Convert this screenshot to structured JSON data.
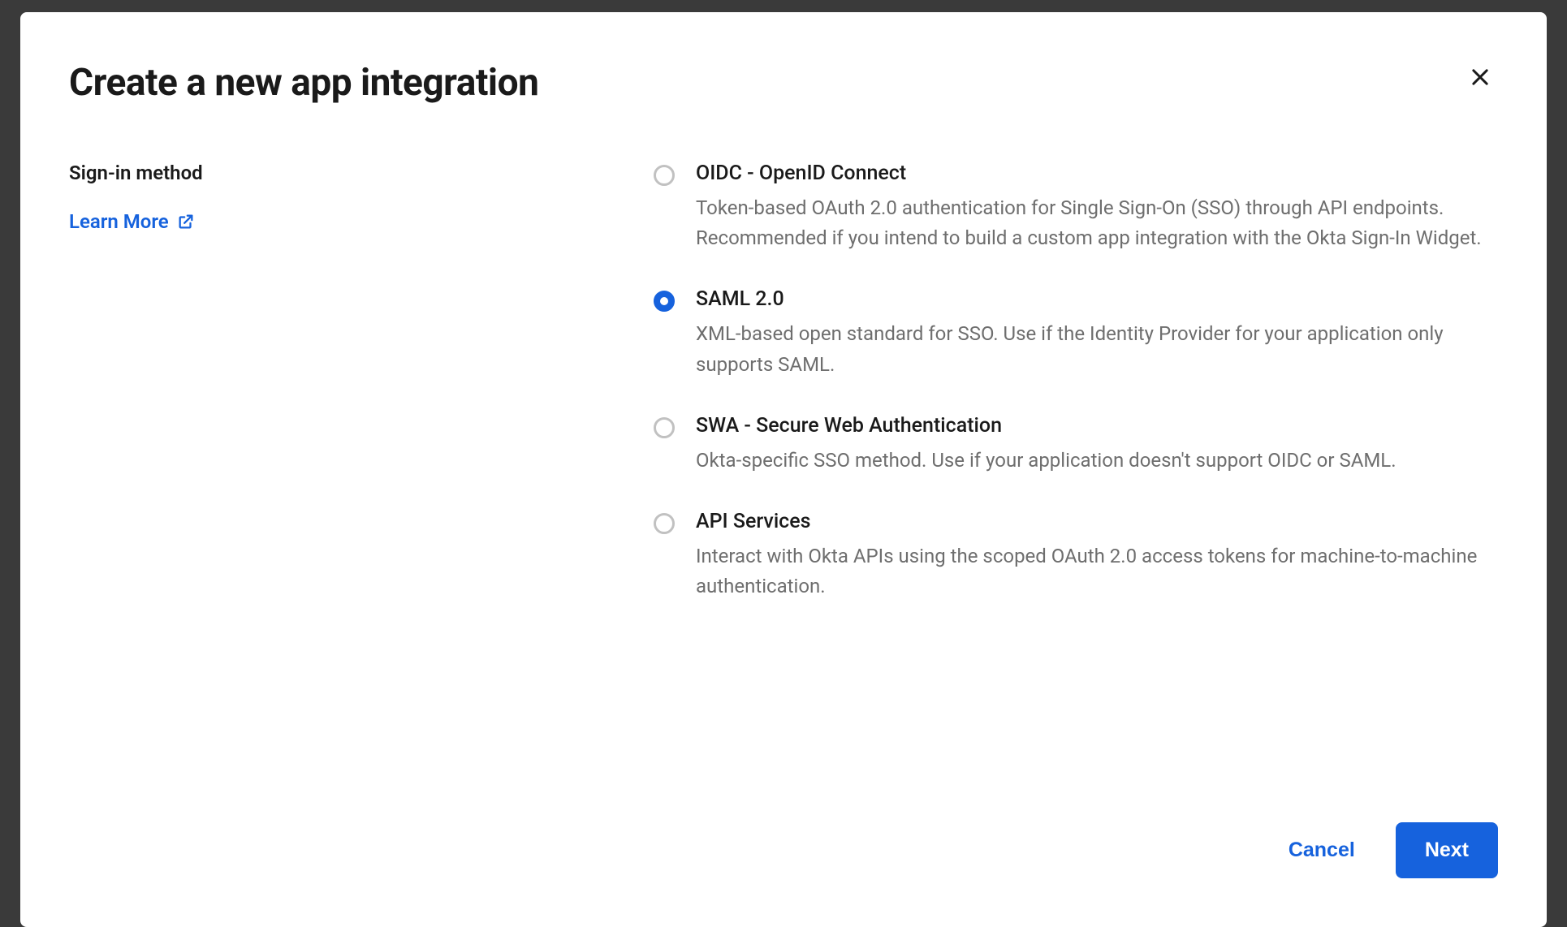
{
  "modal": {
    "title": "Create a new app integration",
    "section_label": "Sign-in method",
    "learn_more": "Learn More",
    "options": [
      {
        "id": "oidc",
        "title": "OIDC - OpenID Connect",
        "desc": "Token-based OAuth 2.0 authentication for Single Sign-On (SSO) through API endpoints. Recommended if you intend to build a custom app integration with the Okta Sign-In Widget.",
        "selected": false
      },
      {
        "id": "saml",
        "title": "SAML 2.0",
        "desc": "XML-based open standard for SSO. Use if the Identity Provider for your application only supports SAML.",
        "selected": true
      },
      {
        "id": "swa",
        "title": "SWA - Secure Web Authentication",
        "desc": "Okta-specific SSO method. Use if your application doesn't support OIDC or SAML.",
        "selected": false
      },
      {
        "id": "api",
        "title": "API Services",
        "desc": "Interact with Okta APIs using the scoped OAuth 2.0 access tokens for machine-to-machine authentication.",
        "selected": false
      }
    ],
    "footer": {
      "cancel": "Cancel",
      "next": "Next"
    }
  }
}
